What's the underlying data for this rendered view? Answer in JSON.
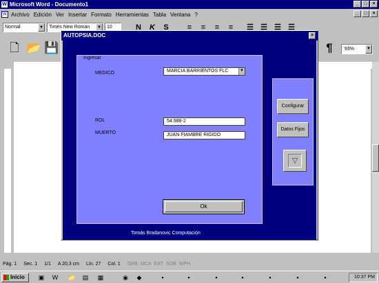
{
  "window": {
    "title": "Microsoft Word - Documento1"
  },
  "menu": {
    "items": [
      {
        "label": "Archivo"
      },
      {
        "label": "Edición"
      },
      {
        "label": "Ver"
      },
      {
        "label": "Insertar"
      },
      {
        "label": "Formato"
      },
      {
        "label": "Herramientas"
      },
      {
        "label": "Tabla"
      },
      {
        "label": "Ventana"
      },
      {
        "label": "?"
      }
    ]
  },
  "format_toolbar": {
    "style_value": "Normal",
    "font_value": "Times New Roman",
    "size_value": "10"
  },
  "standard_toolbar": {
    "zoom_value": "93%"
  },
  "dialog": {
    "title": "AUTOPSIA.DOC",
    "group_label": "Ingresar",
    "medico_label": "MEDICO",
    "medico_value": "MARCIA BARRIENTOS FLC",
    "rol_label": "ROL",
    "rol_value": "54.988-2",
    "muerto_label": "MUERTO",
    "muerto_value": "JUAN FIAMBRE RIGIDO",
    "ok_label": "Ok",
    "configurar_label": "Configurar",
    "datos_fijos_label": "Datos Fijos",
    "credit": "Tomás Bradanovic Computación"
  },
  "statusbar": {
    "page": "Pág. 1",
    "section": "Sec. 1",
    "page_of": "1/1",
    "position": "A 20,3 cm",
    "line": "Lín. 27",
    "col": "Col. 1",
    "modes": [
      "GRB",
      "MCA",
      "EXT",
      "SOB",
      "WPH"
    ]
  },
  "taskbar": {
    "start_label": "Inicio",
    "clock": "10:37 PM"
  }
}
